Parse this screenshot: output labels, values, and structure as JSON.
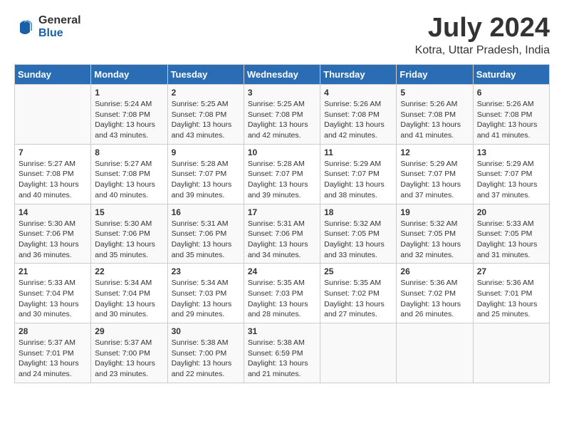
{
  "header": {
    "logo_general": "General",
    "logo_blue": "Blue",
    "month": "July 2024",
    "location": "Kotra, Uttar Pradesh, India"
  },
  "weekdays": [
    "Sunday",
    "Monday",
    "Tuesday",
    "Wednesday",
    "Thursday",
    "Friday",
    "Saturday"
  ],
  "weeks": [
    [
      {
        "day": "",
        "info": ""
      },
      {
        "day": "1",
        "info": "Sunrise: 5:24 AM\nSunset: 7:08 PM\nDaylight: 13 hours\nand 43 minutes."
      },
      {
        "day": "2",
        "info": "Sunrise: 5:25 AM\nSunset: 7:08 PM\nDaylight: 13 hours\nand 43 minutes."
      },
      {
        "day": "3",
        "info": "Sunrise: 5:25 AM\nSunset: 7:08 PM\nDaylight: 13 hours\nand 42 minutes."
      },
      {
        "day": "4",
        "info": "Sunrise: 5:26 AM\nSunset: 7:08 PM\nDaylight: 13 hours\nand 42 minutes."
      },
      {
        "day": "5",
        "info": "Sunrise: 5:26 AM\nSunset: 7:08 PM\nDaylight: 13 hours\nand 41 minutes."
      },
      {
        "day": "6",
        "info": "Sunrise: 5:26 AM\nSunset: 7:08 PM\nDaylight: 13 hours\nand 41 minutes."
      }
    ],
    [
      {
        "day": "7",
        "info": "Sunrise: 5:27 AM\nSunset: 7:08 PM\nDaylight: 13 hours\nand 40 minutes."
      },
      {
        "day": "8",
        "info": "Sunrise: 5:27 AM\nSunset: 7:08 PM\nDaylight: 13 hours\nand 40 minutes."
      },
      {
        "day": "9",
        "info": "Sunrise: 5:28 AM\nSunset: 7:07 PM\nDaylight: 13 hours\nand 39 minutes."
      },
      {
        "day": "10",
        "info": "Sunrise: 5:28 AM\nSunset: 7:07 PM\nDaylight: 13 hours\nand 39 minutes."
      },
      {
        "day": "11",
        "info": "Sunrise: 5:29 AM\nSunset: 7:07 PM\nDaylight: 13 hours\nand 38 minutes."
      },
      {
        "day": "12",
        "info": "Sunrise: 5:29 AM\nSunset: 7:07 PM\nDaylight: 13 hours\nand 37 minutes."
      },
      {
        "day": "13",
        "info": "Sunrise: 5:29 AM\nSunset: 7:07 PM\nDaylight: 13 hours\nand 37 minutes."
      }
    ],
    [
      {
        "day": "14",
        "info": "Sunrise: 5:30 AM\nSunset: 7:06 PM\nDaylight: 13 hours\nand 36 minutes."
      },
      {
        "day": "15",
        "info": "Sunrise: 5:30 AM\nSunset: 7:06 PM\nDaylight: 13 hours\nand 35 minutes."
      },
      {
        "day": "16",
        "info": "Sunrise: 5:31 AM\nSunset: 7:06 PM\nDaylight: 13 hours\nand 35 minutes."
      },
      {
        "day": "17",
        "info": "Sunrise: 5:31 AM\nSunset: 7:06 PM\nDaylight: 13 hours\nand 34 minutes."
      },
      {
        "day": "18",
        "info": "Sunrise: 5:32 AM\nSunset: 7:05 PM\nDaylight: 13 hours\nand 33 minutes."
      },
      {
        "day": "19",
        "info": "Sunrise: 5:32 AM\nSunset: 7:05 PM\nDaylight: 13 hours\nand 32 minutes."
      },
      {
        "day": "20",
        "info": "Sunrise: 5:33 AM\nSunset: 7:05 PM\nDaylight: 13 hours\nand 31 minutes."
      }
    ],
    [
      {
        "day": "21",
        "info": "Sunrise: 5:33 AM\nSunset: 7:04 PM\nDaylight: 13 hours\nand 30 minutes."
      },
      {
        "day": "22",
        "info": "Sunrise: 5:34 AM\nSunset: 7:04 PM\nDaylight: 13 hours\nand 30 minutes."
      },
      {
        "day": "23",
        "info": "Sunrise: 5:34 AM\nSunset: 7:03 PM\nDaylight: 13 hours\nand 29 minutes."
      },
      {
        "day": "24",
        "info": "Sunrise: 5:35 AM\nSunset: 7:03 PM\nDaylight: 13 hours\nand 28 minutes."
      },
      {
        "day": "25",
        "info": "Sunrise: 5:35 AM\nSunset: 7:02 PM\nDaylight: 13 hours\nand 27 minutes."
      },
      {
        "day": "26",
        "info": "Sunrise: 5:36 AM\nSunset: 7:02 PM\nDaylight: 13 hours\nand 26 minutes."
      },
      {
        "day": "27",
        "info": "Sunrise: 5:36 AM\nSunset: 7:01 PM\nDaylight: 13 hours\nand 25 minutes."
      }
    ],
    [
      {
        "day": "28",
        "info": "Sunrise: 5:37 AM\nSunset: 7:01 PM\nDaylight: 13 hours\nand 24 minutes."
      },
      {
        "day": "29",
        "info": "Sunrise: 5:37 AM\nSunset: 7:00 PM\nDaylight: 13 hours\nand 23 minutes."
      },
      {
        "day": "30",
        "info": "Sunrise: 5:38 AM\nSunset: 7:00 PM\nDaylight: 13 hours\nand 22 minutes."
      },
      {
        "day": "31",
        "info": "Sunrise: 5:38 AM\nSunset: 6:59 PM\nDaylight: 13 hours\nand 21 minutes."
      },
      {
        "day": "",
        "info": ""
      },
      {
        "day": "",
        "info": ""
      },
      {
        "day": "",
        "info": ""
      }
    ]
  ]
}
